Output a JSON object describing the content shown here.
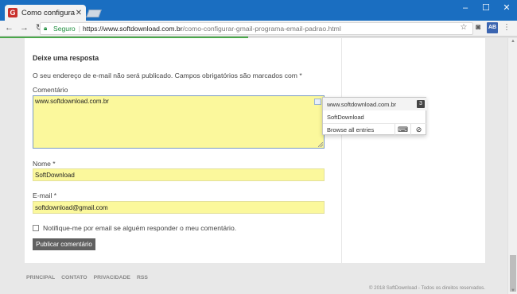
{
  "browser": {
    "tab_title": "Como configurar o Gmai",
    "tab_close": "✕",
    "window_controls": [
      "–",
      "☐",
      "✕"
    ],
    "secure_label": "Seguro",
    "url_host": "https://www.softdownload.com.br",
    "url_path": "/como-configurar-gmail-programa-email-padrao.html",
    "ext_label": "AB",
    "load_progress": 0.48
  },
  "form": {
    "heading": "Deixe uma resposta",
    "note": "O seu endereço de e-mail não será publicado. Campos obrigatórios são marcados com *",
    "comment_label": "Comentário",
    "comment_value": "www.softdownload.com.br",
    "name_label": "Nome *",
    "name_value": "SoftDownload",
    "email_label": "E-mail *",
    "email_value": "softdownload@gmail.com",
    "notify_label": "Notifique-me por email se alguém responder o meu comentário.",
    "submit_label": "Publicar comentário"
  },
  "autocomplete": {
    "items": [
      "www.softdownload.com.br",
      "SoftDownload"
    ],
    "count_badge": "3",
    "browse_all": "Browse all entries"
  },
  "footer": {
    "links": [
      "PRINCIPAL",
      "CONTATO",
      "PRIVACIDADE",
      "RSS"
    ],
    "copyright": "© 2018 SoftDownload - Todos os direitos reservados."
  }
}
